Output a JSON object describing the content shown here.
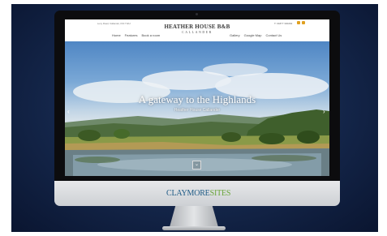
{
  "site": {
    "address": "Leny Road, Callander, FK17 8AJ",
    "phone": "T: 01877 330292",
    "logo_title": "HEATHER HOUSE B&B",
    "logo_subtitle": "CALLANDER",
    "nav_left": [
      "Home",
      "Features",
      "Book a room"
    ],
    "nav_right": [
      "Gallery",
      "Google Map",
      "Contact Us"
    ]
  },
  "hero": {
    "headline": "A gateway to the Highlands",
    "subline": "Heather House Callander",
    "prev_glyph": "‹",
    "next_glyph": "›",
    "scroll_glyph": "⌄"
  },
  "brand": {
    "part1": "CLAYMORE",
    "part2": "SITES"
  },
  "icons": [
    "location-pin-icon",
    "mail-icon",
    "chevron-left-icon",
    "chevron-right-icon",
    "chevron-down-icon"
  ],
  "colors": {
    "background": "#14264a",
    "brand_blue": "#1f5b86",
    "brand_green": "#6aa53a",
    "accent_icon": "#e0a020"
  }
}
